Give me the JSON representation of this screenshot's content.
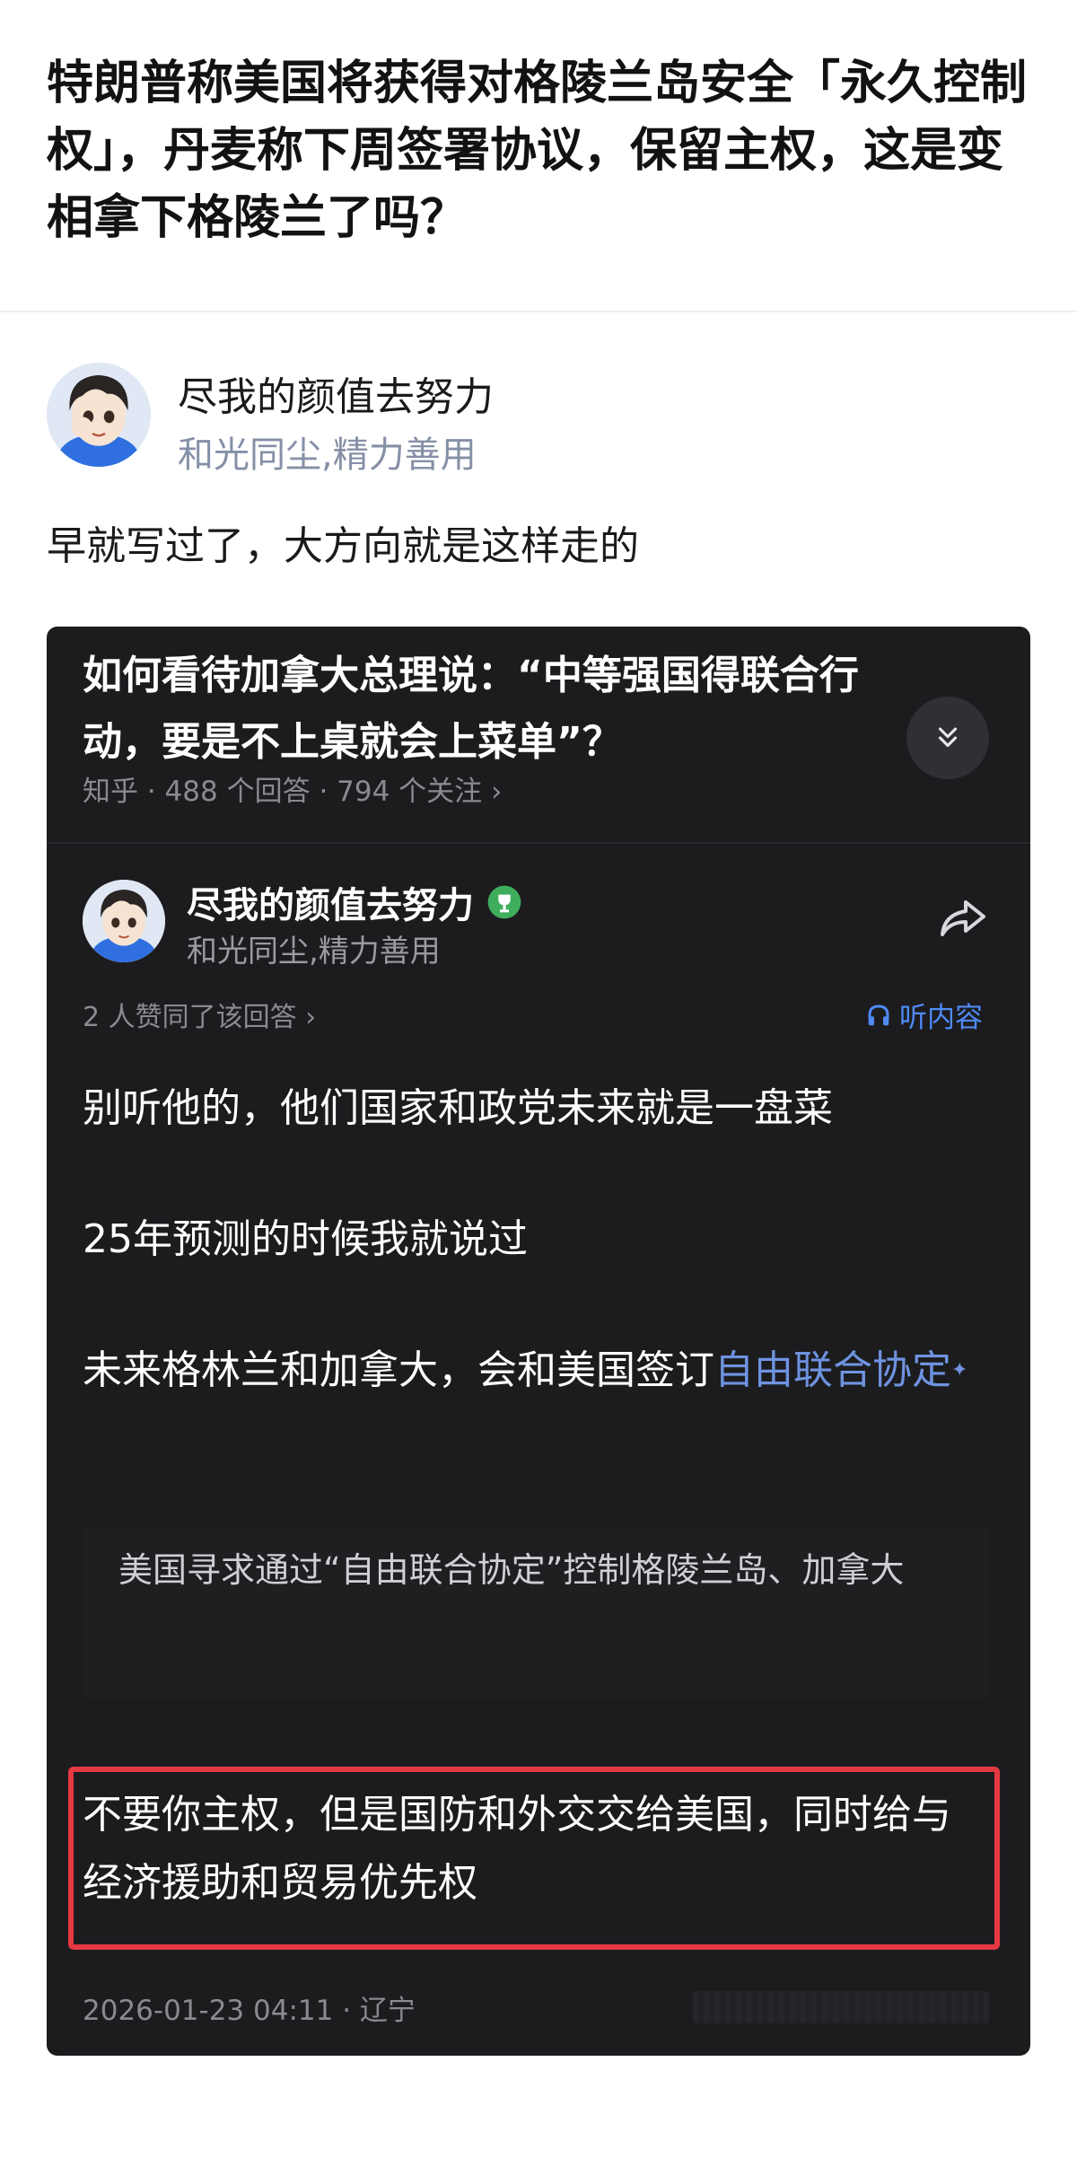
{
  "question": {
    "title": "特朗普称美国将获得对格陵兰岛安全「永久控制权」，丹麦称下周签署协议，保留主权，这是变相拿下格陵兰了吗？"
  },
  "answer": {
    "author_name": "尽我的颜值去努力",
    "author_bio": "和光同尘,精力善用",
    "text": "早就写过了，大方向就是这样走的"
  },
  "embedded_card": {
    "title": "如何看待加拿大总理说：“中等强国得联合行动，要是不上桌就会上菜单”？",
    "meta": "知乎 · 488 个回答 · 794 个关注 ›",
    "expand_icon": "chevron-double-down-icon",
    "author_name": "尽我的颜值去努力",
    "author_bio": "和光同尘,精力善用",
    "badge_icon": "trophy-badge-icon",
    "share_icon": "share-icon",
    "upvote_info": "2 人赞同了该回答 ›",
    "listen_label": "听内容",
    "paragraphs": {
      "p1": "别听他的，他们国家和政党未来就是一盘菜",
      "p2": "25年预测的时候我就说过",
      "p3_prefix": "未来格林兰和加拿大，会和美国签订",
      "p3_link": "自由联合协定"
    },
    "quote": "美国寻求通过“自由联合协定”控制格陵兰岛、加拿大",
    "highlight": "不要你主权，但是国防和外交交给美国，同时给与经济援助和贸易优先权",
    "footer": "2026-01-23 04:11 · 辽宁"
  },
  "colors": {
    "card_background": "#1c1c1f",
    "link": "#6f93e0",
    "listen_link": "#4f8af5",
    "highlight_border": "#e53942",
    "secondary_text": "#8590a6"
  }
}
